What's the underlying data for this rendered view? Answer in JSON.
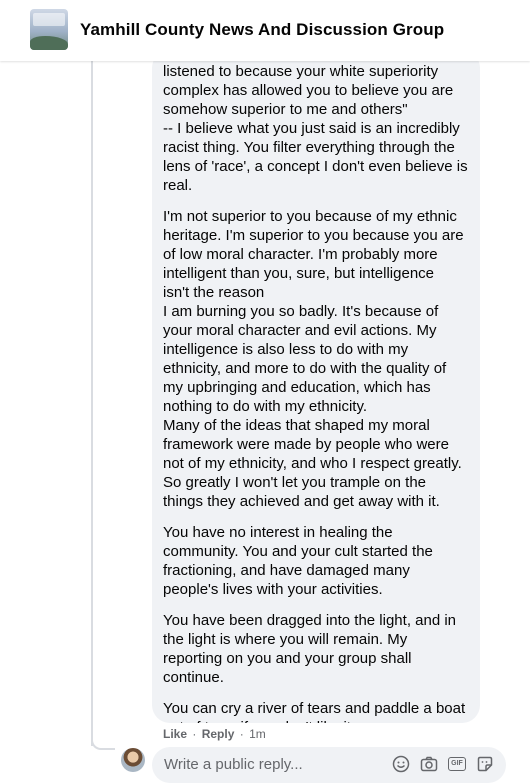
{
  "header": {
    "group_name": "Yamhill County News And Discussion Group"
  },
  "comment": {
    "paragraphs": [
      "listened to because your white superiority\ncomplex has allowed you to believe you are\nsomehow superior to me and others\"\n-- I believe what you just said is an incredibly\nracist thing. You filter everything through the\nlens of 'race', a concept I don't even believe is\nreal.",
      "I'm not superior to you because of my ethnic\nheritage. I'm superior to you because you are\nof low moral character. I'm probably more\nintelligent than you, sure, but intelligence\nisn't the reason\nI am burning you so badly. It's because of\nyour moral character and evil actions. My\nintelligence is also less to do with my\nethnicity, and more to do with the quality of\nmy upbringing and education, which has\nnothing to do with my ethnicity.\nMany of the ideas that shaped my moral\nframework were made by people who were\nnot of my ethnicity, and who I respect greatly.\nSo greatly I won't let you trample on the\nthings they achieved and get away with it.",
      "You have no interest in healing the\ncommunity. You and your cult started the\nfractioning, and have damaged many\npeople's lives with your activities.",
      "You have been dragged into the light, and in\nthe light is where you will remain. My\nreporting on you and your group shall\ncontinue.",
      "You can cry a river of tears and paddle a boat\nout of town if you don't like it."
    ]
  },
  "actions": {
    "like_label": "Like",
    "separator": "·",
    "reply_label": "Reply",
    "timestamp": "1m"
  },
  "reply_box": {
    "placeholder": "Write a public reply..."
  },
  "icons": {
    "emoji": "emoji-icon",
    "camera": "camera-icon",
    "gif": "GIF",
    "sticker": "sticker-icon"
  }
}
